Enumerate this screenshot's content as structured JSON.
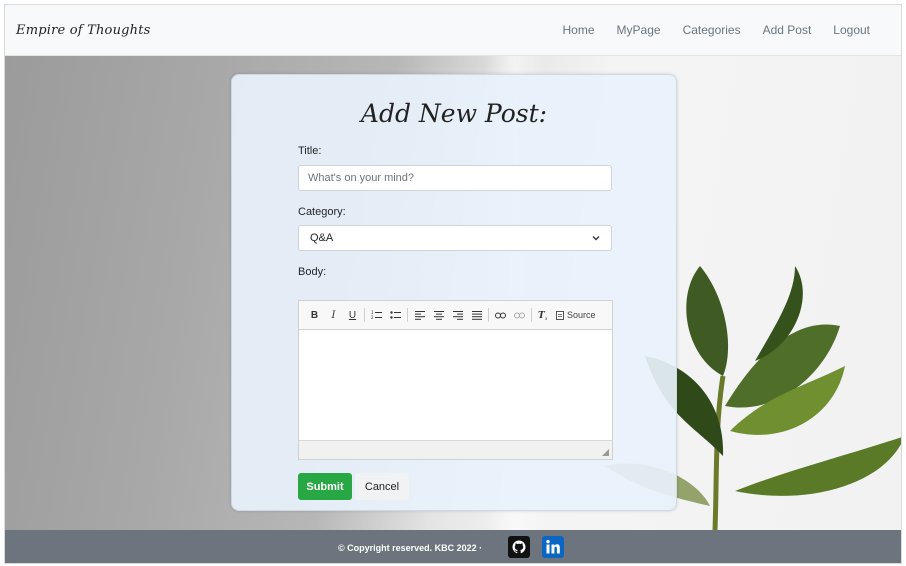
{
  "navbar": {
    "brand": "Empire of Thoughts",
    "links": [
      "Home",
      "MyPage",
      "Categories",
      "Add Post",
      "Logout"
    ]
  },
  "form": {
    "heading": "Add New Post:",
    "title_label": "Title:",
    "title_placeholder": "What's on your mind?",
    "category_label": "Category:",
    "category_value": "Q&A",
    "body_label": "Body:",
    "toolbar": {
      "bold": "B",
      "italic": "I",
      "underline": "U",
      "source": "Source"
    },
    "submit_label": "Submit",
    "cancel_label": "Cancel"
  },
  "footer": {
    "copyright": "© Copyright reserved. KBC 2022 ·"
  },
  "colors": {
    "submit": "#28a745",
    "footer": "#6c757d",
    "navbar": "#f8f9fa",
    "linkedin": "#0a66c2"
  }
}
